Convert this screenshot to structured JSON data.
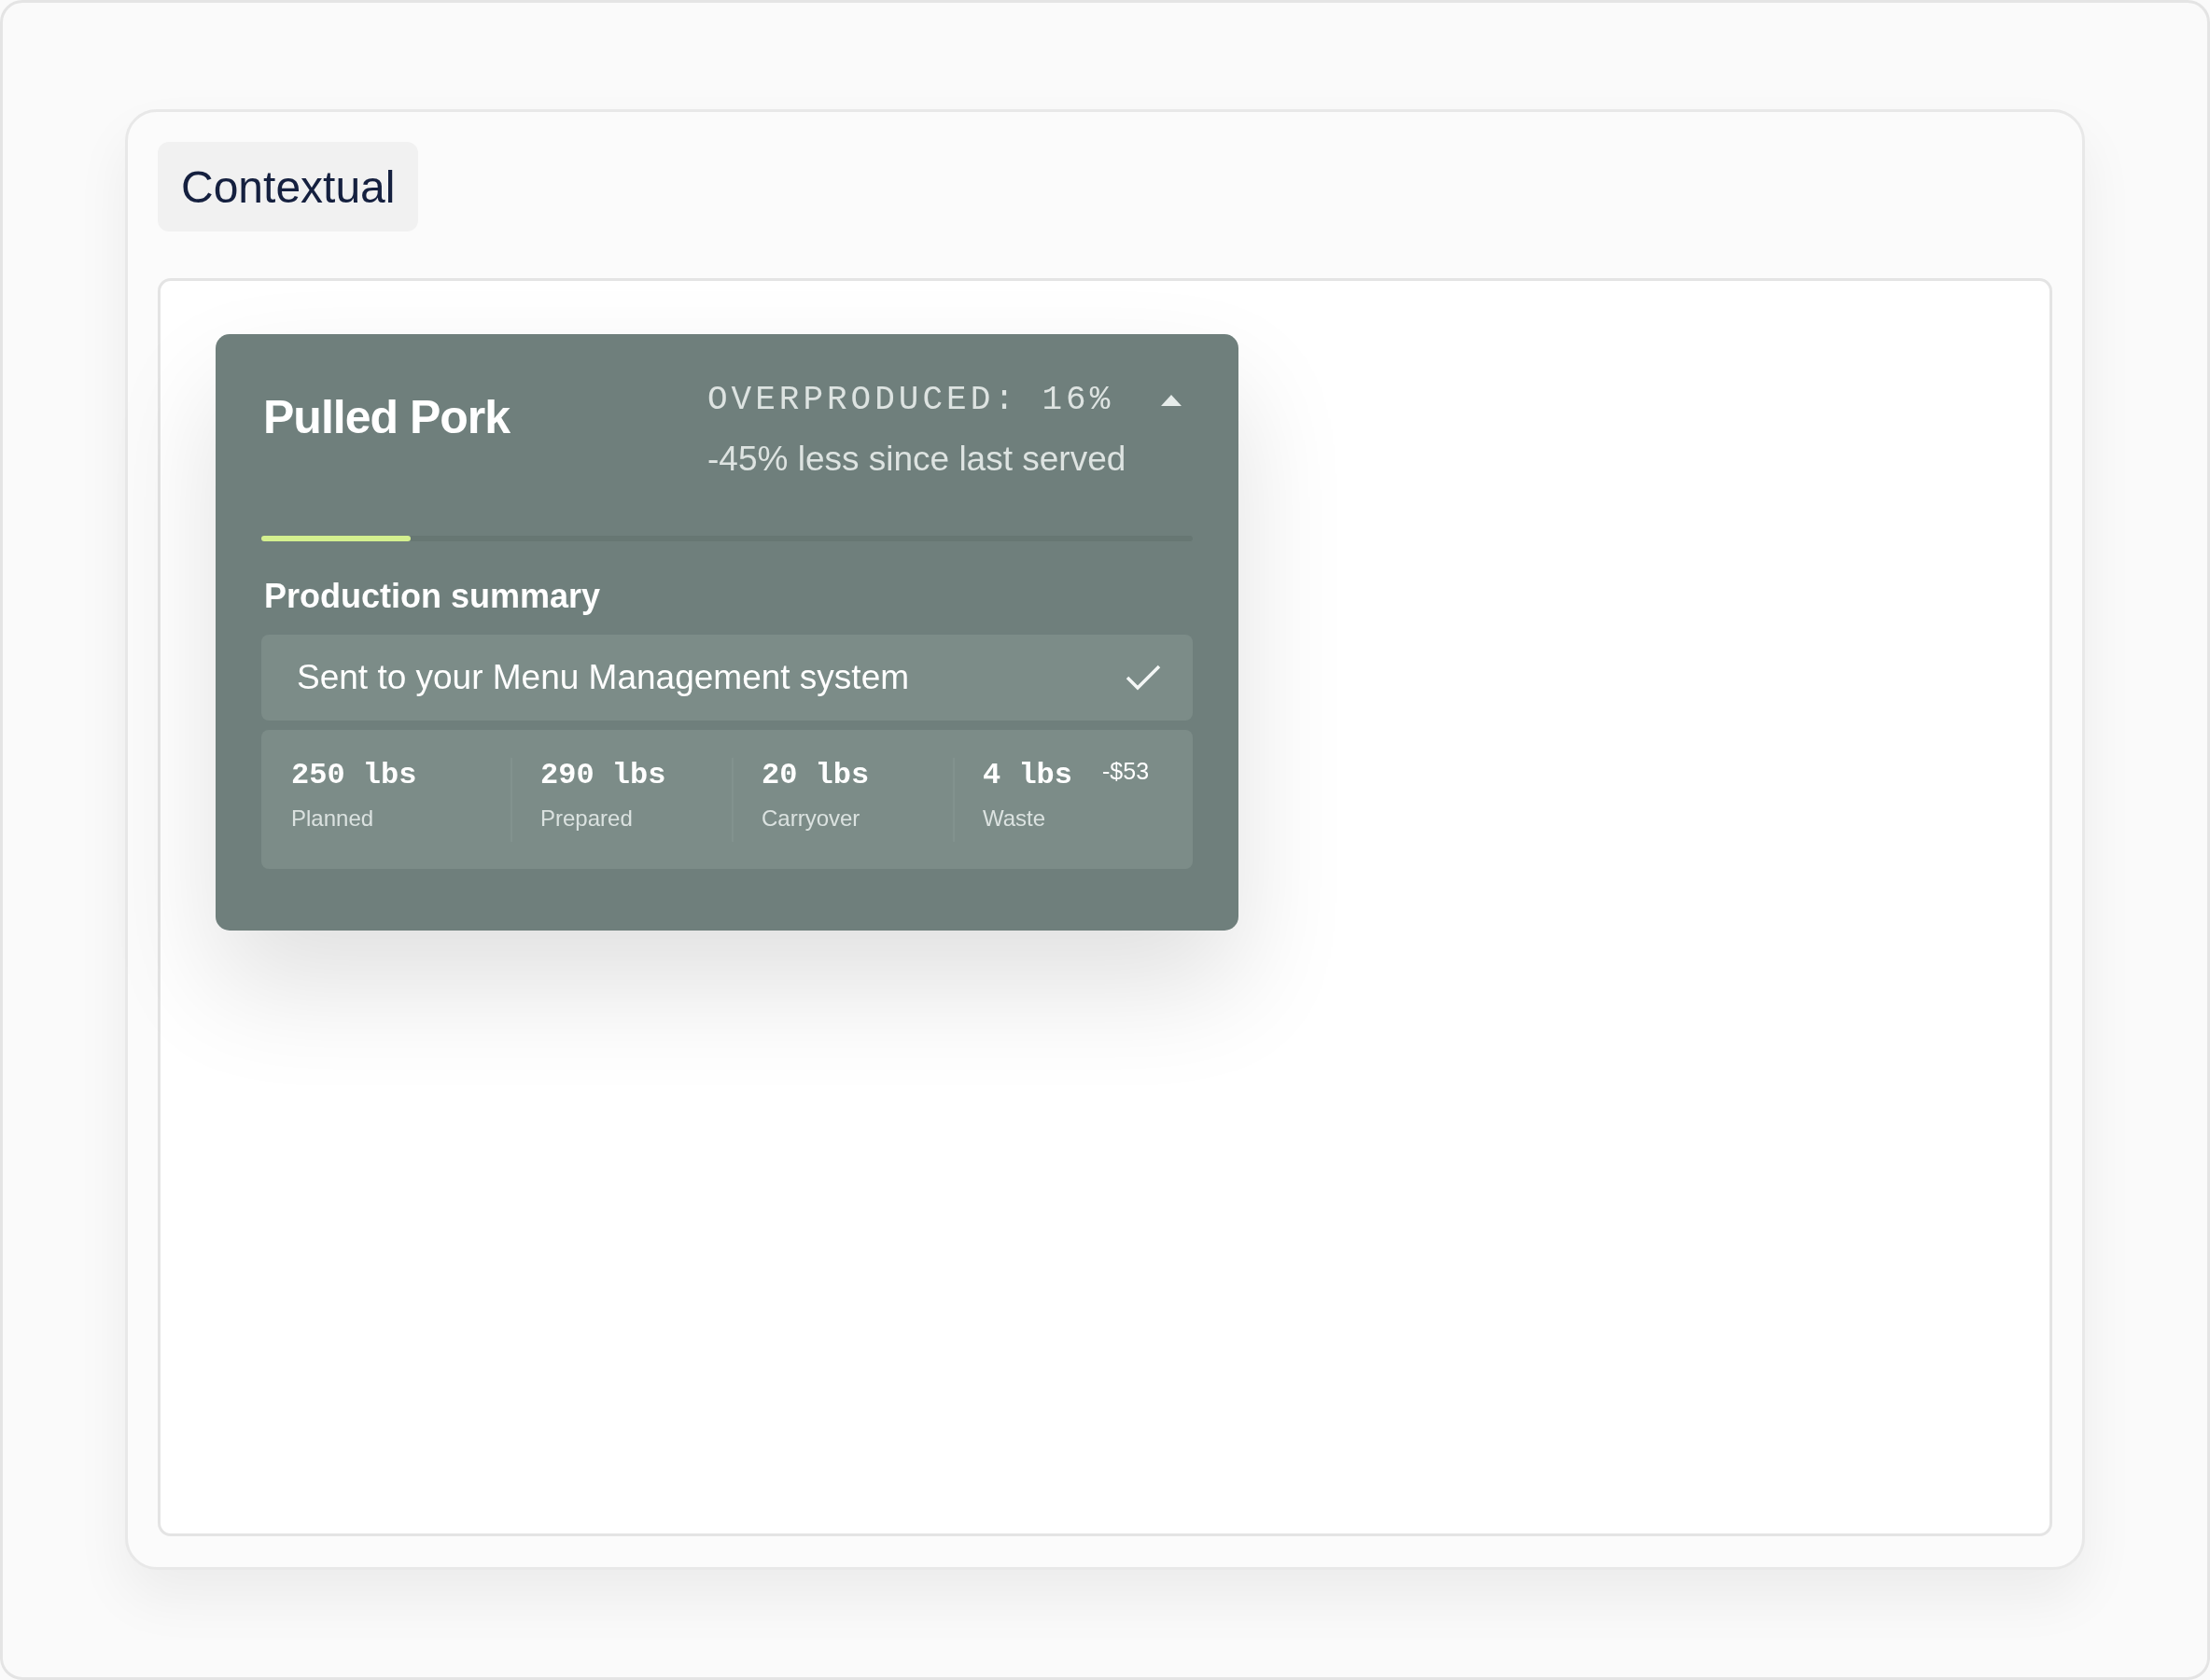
{
  "tag": "Contextual",
  "card": {
    "title": "Pulled Pork",
    "status": "OVERPRODUCED: 16%",
    "expanded": true,
    "change": "-45% less since last served",
    "level": 0.16,
    "section_title": "Production summary",
    "notice": {
      "text": "Sent to your Menu Management system",
      "done": true
    },
    "stats": [
      {
        "value": "250 lbs",
        "label": "Planned"
      },
      {
        "value": "290 lbs",
        "label": "Prepared"
      },
      {
        "value": "20 lbs",
        "label": "Carryover"
      },
      {
        "value": "4 lbs",
        "label": "Waste",
        "note": "-$53"
      }
    ]
  }
}
